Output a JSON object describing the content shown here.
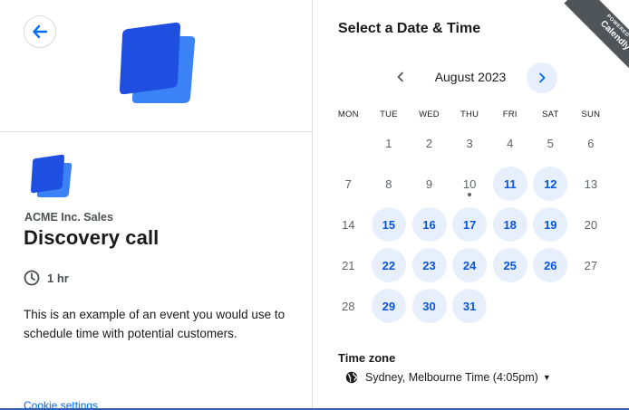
{
  "event": {
    "org_name": "ACME Inc. Sales",
    "title": "Discovery call",
    "duration": "1 hr",
    "description": "This is an example of an event you would use to schedule time with potential customers.",
    "cookie_link": "Cookie settings"
  },
  "picker": {
    "heading": "Select a Date & Time",
    "month": "August 2023",
    "weekdays": [
      "MON",
      "TUE",
      "WED",
      "THU",
      "FRI",
      "SAT",
      "SUN"
    ],
    "first_weekday_index": 1,
    "days_in_month": 31,
    "available_days": [
      11,
      12,
      15,
      16,
      17,
      18,
      19,
      22,
      23,
      24,
      25,
      26,
      29,
      30,
      31
    ],
    "today": 10
  },
  "timezone": {
    "label": "Time zone",
    "value": "Sydney, Melbourne Time (4:05pm)"
  },
  "ribbon": {
    "line1": "POWERED BY",
    "line2": "Calendly"
  },
  "colors": {
    "accent": "#0069ff",
    "available_bg": "#e8effc",
    "available_text": "#0a55d9",
    "logo_dark": "#1e4fe0",
    "logo_light": "#3b82f6"
  },
  "icons": [
    "arrow-left-icon",
    "clock-icon",
    "chevron-left-icon",
    "chevron-right-icon",
    "globe-icon",
    "caret-down-icon"
  ]
}
